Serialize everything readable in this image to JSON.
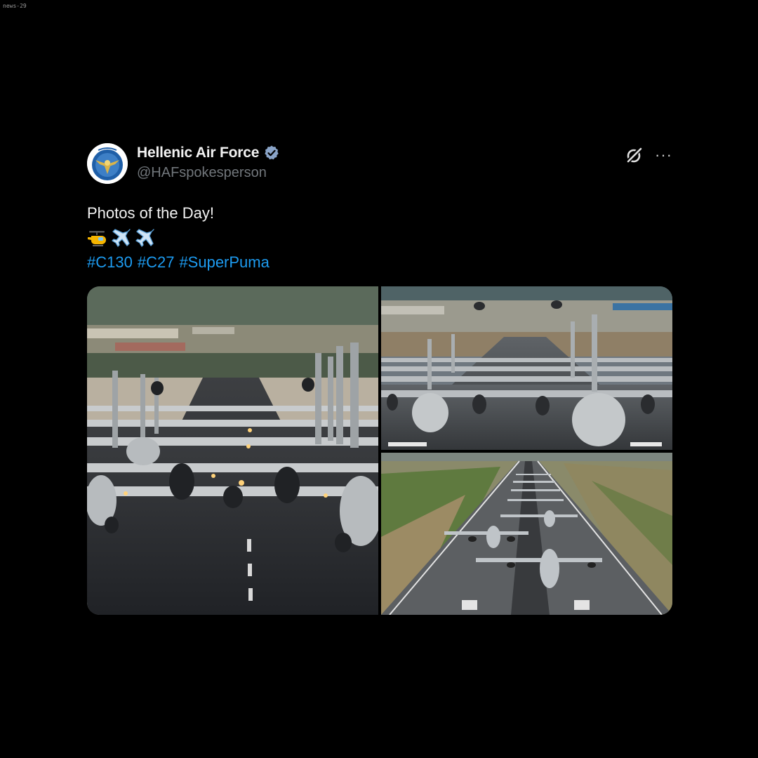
{
  "watermark": "news-29",
  "tweet": {
    "author": {
      "display_name": "Hellenic Air Force",
      "handle": "@HAFspokesperson",
      "verified": true,
      "avatar_icon": "hellenic-air-force-emblem"
    },
    "text": "Photos of the Day!",
    "emojis": [
      "helicopter-emoji",
      "airplane-emoji",
      "airplane-emoji"
    ],
    "hashtags": [
      "#C130",
      "#C27",
      "#SuperPuma"
    ],
    "actions": {
      "grok_icon": "grok-icon",
      "more_icon": "more-options-icon",
      "more_label": "···"
    },
    "media": {
      "photos": [
        {
          "icon": "photo-aircraft-lineup-closeup"
        },
        {
          "icon": "photo-aircraft-lineup-helicopters"
        },
        {
          "icon": "photo-aircraft-runway-aerial"
        }
      ]
    }
  },
  "colors": {
    "background": "#000000",
    "text": "#e7e9ea",
    "secondary": "#71767b",
    "link": "#1d9bf0",
    "verified": "#8aa4c8"
  }
}
